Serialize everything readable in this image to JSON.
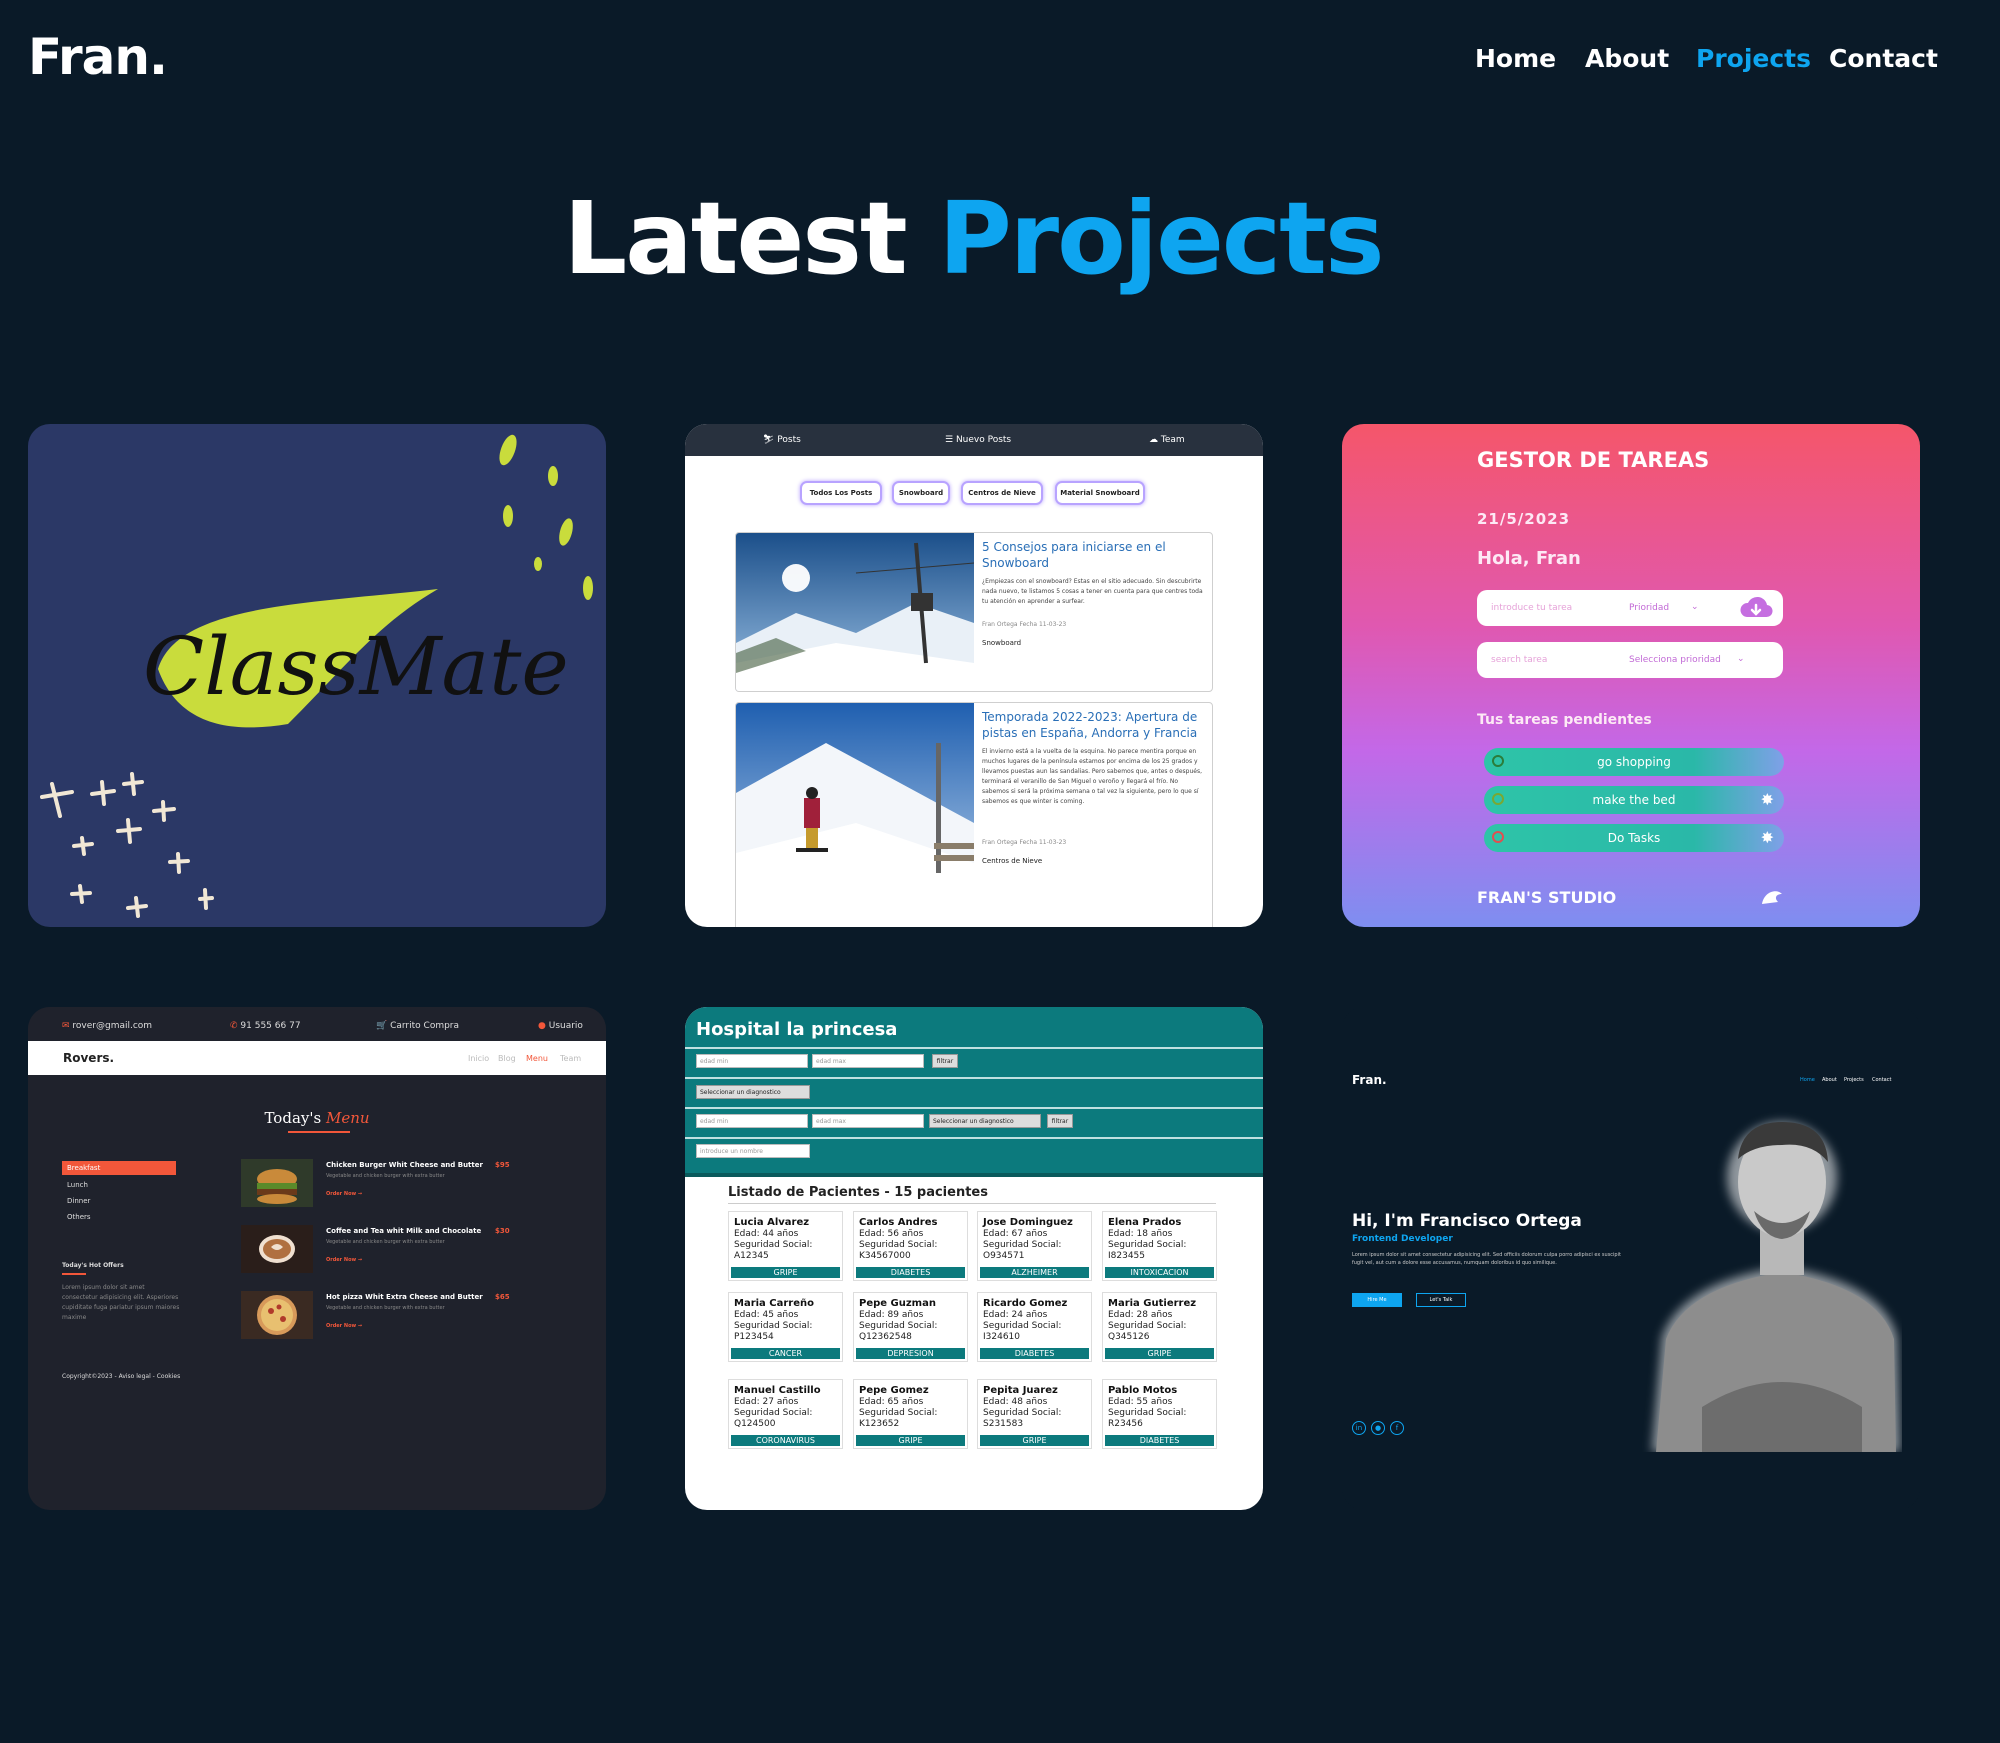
{
  "header": {
    "logo": "Fran.",
    "nav": [
      "Home",
      "About",
      "Projects",
      "Contact"
    ],
    "active": "Projects"
  },
  "hero": {
    "title_part1": "Latest",
    "title_part2": "Projects"
  },
  "colors": {
    "background": "#0a1a28",
    "accent": "#0ea5f0"
  },
  "projects": {
    "classmate": {
      "logo_text": "ClassMate"
    },
    "snowboard": {
      "nav": [
        "Posts",
        "Nuevo Posts",
        "Team"
      ],
      "filters": [
        "Todos Los Posts",
        "Snowboard",
        "Centros de Nieve",
        "Material Snowboard"
      ],
      "posts": [
        {
          "title": "5 Consejos para iniciarse en el Snowboard",
          "body": "¿Empiezas con el snowboard? Estas en el sitio adecuado. Sin descubrirte nada nuevo, te listamos 5 cosas a tener en cuenta para que centres toda tu atención en aprender a surfear.",
          "meta": "Fran Ortega Fecha 11-03-23",
          "tag": "Snowboard"
        },
        {
          "title": "Temporada 2022-2023: Apertura de pistas en España, Andorra y Francia",
          "body": "El invierno está a la vuelta de la esquina. No parece mentira porque en muchos lugares de la península estamos por encima de los 25 grados y llevamos puestas aun las sandalias. Pero sabemos que, antes o después, terminará el veranillo de San Miguel o veroño y llegará el frío. No sabemos si será la próxima semana o tal vez la siguiente, pero lo que sí sabemos es que winter is coming.",
          "meta": "Fran Ortega Fecha 11-03-23",
          "tag": "Centros de Nieve"
        }
      ]
    },
    "tareas": {
      "title": "GESTOR DE TAREAS",
      "date": "21/5/2023",
      "greeting": "Hola, Fran",
      "task_placeholder": "introduce tu tarea",
      "priority_label": "Prioridad",
      "search_placeholder": "search tarea",
      "priority_select": "Selecciona prioridad",
      "pending_label": "Tus tareas pendientes",
      "tasks": [
        "go shopping",
        "make the bed",
        "Do Tasks"
      ],
      "footer": "FRAN'S STUDIO"
    },
    "rovers": {
      "email": "rover@gmail.com",
      "phone": "91 555 66 77",
      "cart": "Carrito Compra",
      "user": "Usuario",
      "brand": "Rovers.",
      "nav": [
        "Inicio",
        "Blog",
        "Menu",
        "Team"
      ],
      "menu_title_1": "Today's",
      "menu_title_2": "Menu",
      "categories": [
        "Breakfast",
        "Lunch",
        "Dinner",
        "Others"
      ],
      "offers_title": "Today's Hot Offers",
      "offers_text": "Lorem ipsum dolor sit amet consectetur adipisicing elit. Asperiores cupiditate fuga pariatur ipsum maiores maxime",
      "items": [
        {
          "name": "Chicken Burger Whit Cheese and Butter",
          "price": "$95",
          "desc": "Vegetable and chicken burger with extra butter",
          "cta": "Order Now →"
        },
        {
          "name": "Coffee and Tea whit Milk and Chocolate",
          "price": "$30",
          "desc": "Vegetable and chicken burger with extra butter",
          "cta": "Order Now →"
        },
        {
          "name": "Hot pizza Whit Extra Cheese and Butter",
          "price": "$65",
          "desc": "Vegetable and chicken burger with extra butter",
          "cta": "Order Now →"
        }
      ],
      "footer": "Copyright©2023 - Aviso legal - Cookies"
    },
    "hospital": {
      "title": "Hospital la princesa",
      "edad_min": "edad min",
      "edad_max": "edad max",
      "filtrar": "filtrar",
      "select_diag": "Seleccionar un diagnostico",
      "name_placeholder": "introduce un nombre",
      "list_title": "Listado de Pacientes - 15 pacientes",
      "age_prefix": "Edad:",
      "ss_label": "Seguridad Social:",
      "patients": [
        {
          "name": "Lucia Alvarez",
          "age": "44 años",
          "ss": "A12345",
          "diag": "GRIPE"
        },
        {
          "name": "Carlos Andres",
          "age": "56 años",
          "ss": "K34567000",
          "diag": "DIABETES"
        },
        {
          "name": "Jose Dominguez",
          "age": "67 años",
          "ss": "O934571",
          "diag": "ALZHEIMER"
        },
        {
          "name": "Elena Prados",
          "age": "18 años",
          "ss": "I823455",
          "diag": "INTOXICACION"
        },
        {
          "name": "Maria Carreño",
          "age": "45 años",
          "ss": "P123454",
          "diag": "CANCER"
        },
        {
          "name": "Pepe Guzman",
          "age": "89 años",
          "ss": "Q12362548",
          "diag": "DEPRESION"
        },
        {
          "name": "Ricardo Gomez",
          "age": "24 años",
          "ss": "I324610",
          "diag": "DIABETES"
        },
        {
          "name": "Maria Gutierrez",
          "age": "28 años",
          "ss": "Q345126",
          "diag": "GRIPE"
        },
        {
          "name": "Manuel Castillo",
          "age": "27 años",
          "ss": "Q124500",
          "diag": "CORONAVIRUS"
        },
        {
          "name": "Pepe Gomez",
          "age": "65 años",
          "ss": "K123652",
          "diag": "GRIPE"
        },
        {
          "name": "Pepita Juarez",
          "age": "48 años",
          "ss": "S231583",
          "diag": "GRIPE"
        },
        {
          "name": "Pablo Motos",
          "age": "55 años",
          "ss": "R23456",
          "diag": "DIABETES"
        }
      ]
    },
    "portfolio": {
      "logo": "Fran.",
      "nav": [
        "Home",
        "About",
        "Projects",
        "Contact"
      ],
      "greeting": "Hi, I'm Francisco Ortega",
      "role": "Frontend Developer",
      "text": "Lorem ipsum dolor sit amet consectetur adipisicing elit. Sed officiis dolorum culpa porro adipisci ex suscipit fugit vel, aut cum a dolore esse accusamus, numquam doloribus id quo similique.",
      "btn1": "Hire Me",
      "btn2": "Let's Talk"
    }
  }
}
